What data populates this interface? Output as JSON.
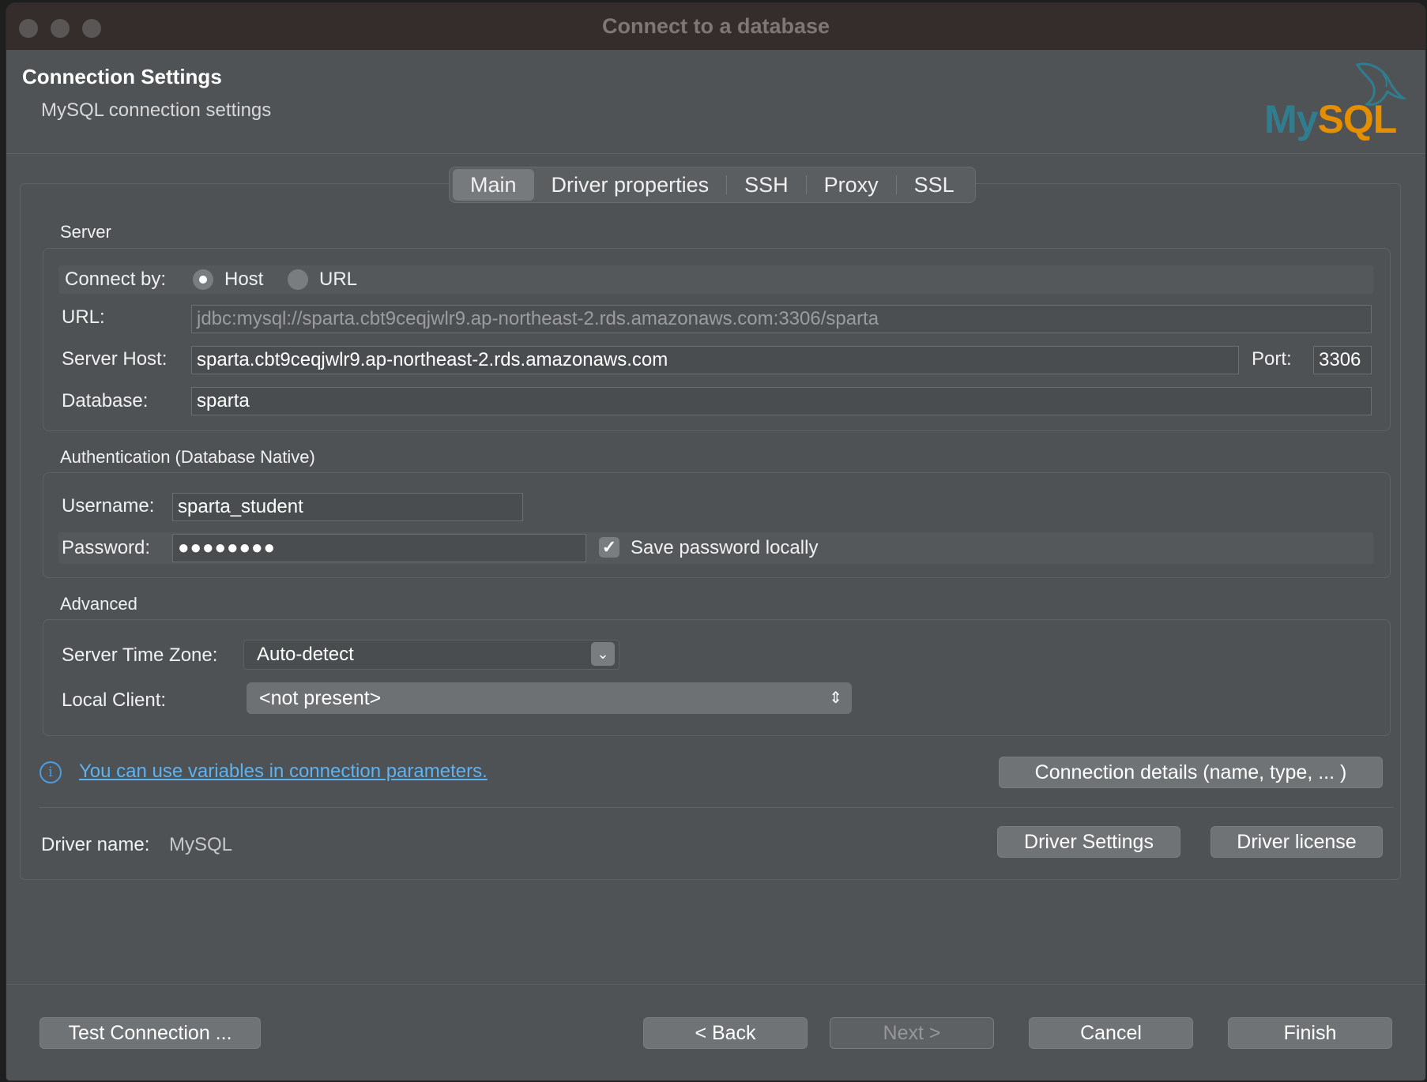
{
  "window": {
    "title": "Connect to a database"
  },
  "header": {
    "title": "Connection Settings",
    "subtitle": "MySQL connection settings",
    "logo_text": "MySQL",
    "logo_colors": {
      "my": "#2f7d8e",
      "sql": "#e48e00"
    }
  },
  "tabs": [
    "Main",
    "Driver properties",
    "SSH",
    "Proxy",
    "SSL"
  ],
  "active_tab": "Main",
  "server": {
    "section_title": "Server",
    "connect_by_label": "Connect by:",
    "connect_by_options": [
      "Host",
      "URL"
    ],
    "connect_by_selected": "Host",
    "url_label": "URL:",
    "url_value": "jdbc:mysql://sparta.cbt9ceqjwlr9.ap-northeast-2.rds.amazonaws.com:3306/sparta",
    "host_label": "Server Host:",
    "host_value": "sparta.cbt9ceqjwlr9.ap-northeast-2.rds.amazonaws.com",
    "port_label": "Port:",
    "port_value": "3306",
    "database_label": "Database:",
    "database_value": "sparta"
  },
  "auth": {
    "section_title": "Authentication (Database Native)",
    "username_label": "Username:",
    "username_value": "sparta_student",
    "password_label": "Password:",
    "password_value": "●●●●●●●●",
    "save_password_label": "Save password locally",
    "save_password_checked": true
  },
  "advanced": {
    "section_title": "Advanced",
    "timezone_label": "Server Time Zone:",
    "timezone_value": "Auto-detect",
    "local_client_label": "Local Client:",
    "local_client_value": "<not present>"
  },
  "info_link": "You can use variables in connection parameters.",
  "connection_details_button": "Connection details (name, type, ... )",
  "driver": {
    "name_label": "Driver name:",
    "name_value": "MySQL",
    "settings_button": "Driver Settings",
    "license_button": "Driver license"
  },
  "footer": {
    "test_button": "Test Connection ...",
    "back_button": "< Back",
    "next_button": "Next >",
    "cancel_button": "Cancel",
    "finish_button": "Finish"
  }
}
